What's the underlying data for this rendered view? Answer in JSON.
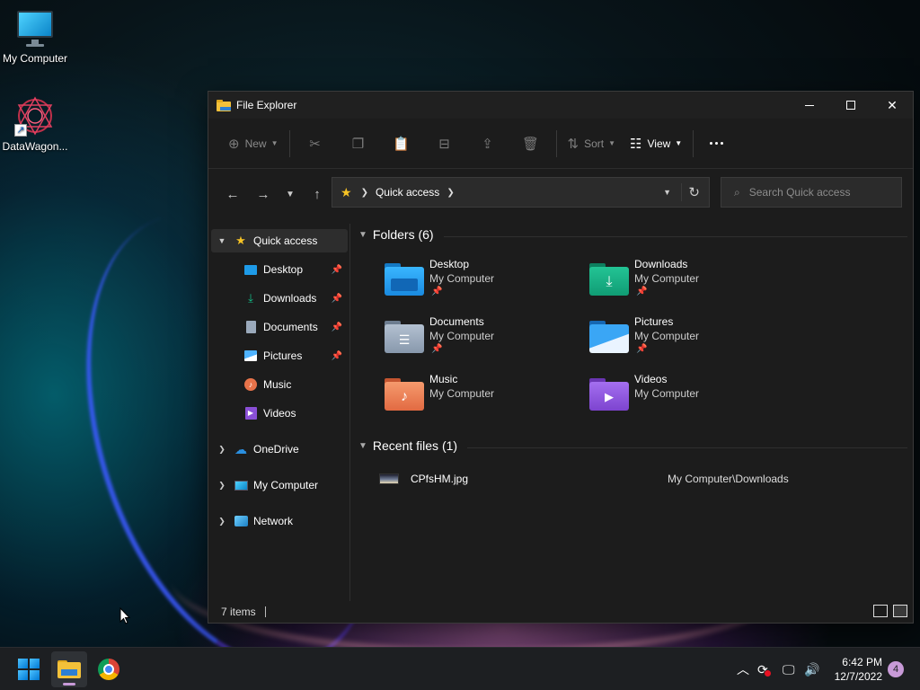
{
  "desktop": {
    "icons": [
      {
        "label": "My Computer",
        "icon": "monitor-icon"
      },
      {
        "label": "DataWagon...",
        "icon": "datawagon-app-icon"
      }
    ]
  },
  "window": {
    "title": "File Explorer",
    "toolbar": {
      "new_label": "New",
      "sort_label": "Sort",
      "view_label": "View"
    },
    "address": {
      "crumb": "Quick access"
    },
    "search": {
      "placeholder": "Search Quick access"
    },
    "sidebar": {
      "quick_access": "Quick access",
      "items": [
        {
          "label": "Desktop",
          "pinned": true
        },
        {
          "label": "Downloads",
          "pinned": true
        },
        {
          "label": "Documents",
          "pinned": true
        },
        {
          "label": "Pictures",
          "pinned": true
        },
        {
          "label": "Music",
          "pinned": false
        },
        {
          "label": "Videos",
          "pinned": false
        }
      ],
      "roots": [
        {
          "label": "OneDrive"
        },
        {
          "label": "My Computer"
        },
        {
          "label": "Network"
        }
      ]
    },
    "folders_header": "Folders (6)",
    "folders": [
      {
        "name": "Desktop",
        "location": "My Computer",
        "pinned": true,
        "color": "#1e9be8"
      },
      {
        "name": "Downloads",
        "location": "My Computer",
        "pinned": true,
        "color": "#13a37b"
      },
      {
        "name": "Documents",
        "location": "My Computer",
        "pinned": true,
        "color": "#8a9bb0"
      },
      {
        "name": "Pictures",
        "location": "My Computer",
        "pinned": true,
        "color": "#2a8fe0"
      },
      {
        "name": "Music",
        "location": "My Computer",
        "pinned": false,
        "color": "#e8734a"
      },
      {
        "name": "Videos",
        "location": "My Computer",
        "pinned": false,
        "color": "#8a4fd6"
      }
    ],
    "recent_header": "Recent files (1)",
    "recent": [
      {
        "name": "CPfsHM.jpg",
        "location": "My Computer\\Downloads"
      }
    ],
    "status": {
      "items": "7 items"
    }
  },
  "taskbar": {
    "time": "6:42 PM",
    "date": "12/7/2022",
    "notification_count": "4"
  },
  "colors": {
    "accent": "#c89ad8",
    "star": "#f6c325"
  }
}
